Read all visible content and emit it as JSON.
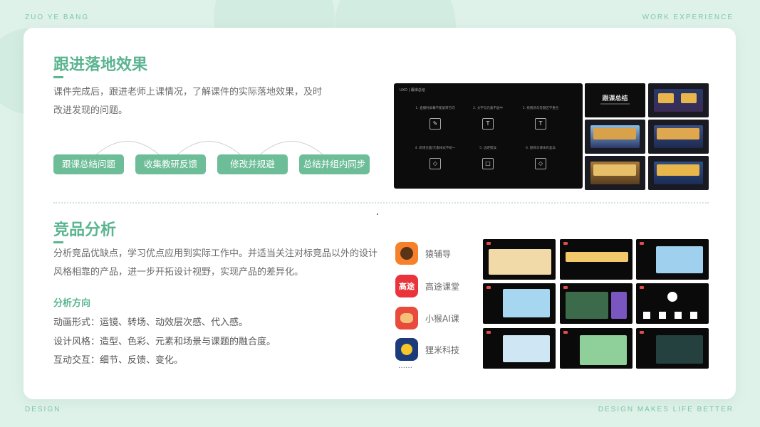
{
  "corners": {
    "top_left": "ZUO YE BANG",
    "top_right": "WORK EXPERIENCE",
    "bottom_left": "DESIGN",
    "bottom_right": "DESIGN MAKES LIFE BETTER"
  },
  "section1": {
    "title": "跟进落地效果",
    "line1": "课件完成后，跟进老师上课情况，了解课件的实际落地效果，及时",
    "line2": "改进发现的问题。",
    "steps": [
      "跟课总结问题",
      "收集教研反馈",
      "修改并规避",
      "总结并组内同步"
    ]
  },
  "section2": {
    "title": "竞品分析",
    "line1": "分析竞品优缺点，学习优点应用到实际工作中。并适当关注对标竞品以外的设计",
    "line2": "风格相靠的产品，进一步开拓设计视野，实现产品的差异化。",
    "subhead": "分析方向",
    "items": [
      "动画形式：运镜、转场、动效层次感、代入感。",
      "设计风格：造型、色彩、元素和场景与课题的融合度。",
      "互动交互：细节、反馈、变化。"
    ]
  },
  "brands": [
    {
      "name": "猿辅导",
      "color": "#f7812b",
      "icon": "monkey-logo-icon",
      "logo_text": ""
    },
    {
      "name": "高途课堂",
      "color": "#e8343a",
      "icon": "gaotu-logo-icon",
      "logo_text": "高途"
    },
    {
      "name": "小猴AI课",
      "color": "#e84b3c",
      "icon": "little-monkey-logo-icon",
      "logo_text": ""
    },
    {
      "name": "狸米科技",
      "color": "#1b3b7a",
      "icon": "limi-logo-icon",
      "logo_text": ""
    }
  ],
  "brands_more": "……",
  "big_shot": {
    "header": "UXD | 跟课总结",
    "cells": [
      {
        "caption": "1. 直播时屏幕不能旋转方向",
        "glyph": "✎"
      },
      {
        "caption": "2. 文字与元素不居中",
        "glyph": "T"
      },
      {
        "caption": "3. 拖拽项与答题区不重合",
        "glyph": "T"
      },
      {
        "caption": "4. 新增页面/元素样式不统一",
        "glyph": "◇"
      },
      {
        "caption": "5. 边距错误",
        "glyph": "□"
      },
      {
        "caption": "6. 题目与课本有差异",
        "glyph": "◇"
      }
    ]
  },
  "summary_thumb_title": "跟课总结"
}
